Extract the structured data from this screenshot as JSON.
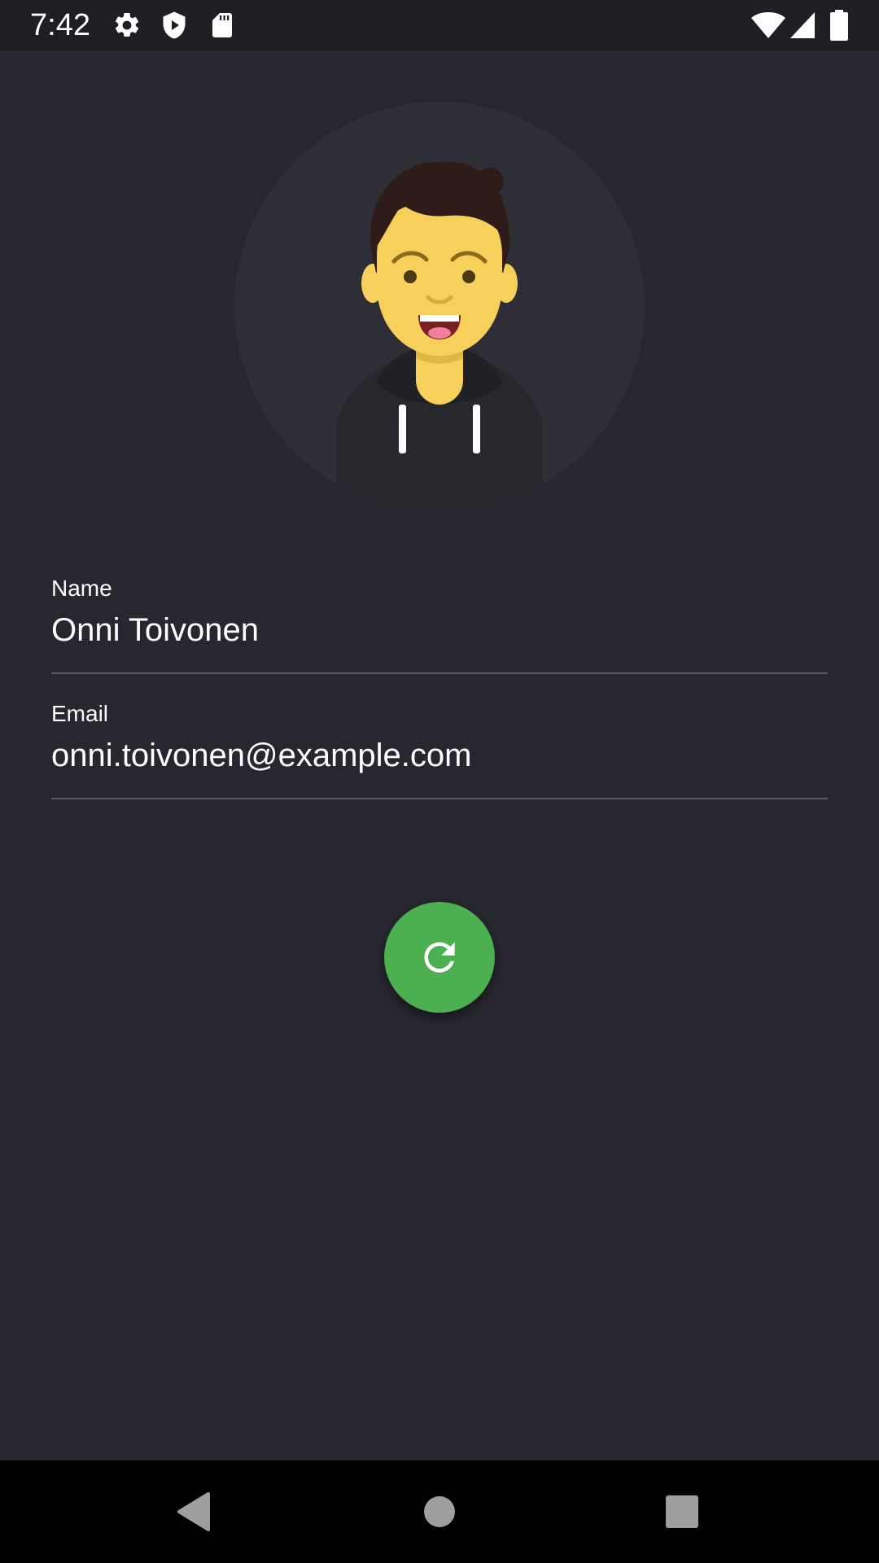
{
  "status_bar": {
    "time": "7:42",
    "left_icons": [
      "gear-icon",
      "shield-play-icon",
      "sd-card-icon"
    ],
    "right_icons": [
      "wifi-icon",
      "cell-signal-icon",
      "battery-icon"
    ]
  },
  "profile": {
    "avatar": "cartoon-person-avatar",
    "fields": {
      "name": {
        "label": "Name",
        "value": "Onni Toivonen"
      },
      "email": {
        "label": "Email",
        "value": "onni.toivonen@example.com"
      }
    }
  },
  "fab": {
    "icon": "refresh-icon",
    "color": "#4caf50"
  },
  "nav_bar": {
    "icons": [
      "back-icon",
      "home-icon",
      "recents-icon"
    ]
  },
  "colors": {
    "background": "#272730",
    "status_bar": "#1e1e23",
    "avatar_circle": "#2d2e36",
    "skin": "#f7d05b",
    "hair": "#2f1b18",
    "accent_green": "#4caf50",
    "nav_bar": "#000000"
  }
}
